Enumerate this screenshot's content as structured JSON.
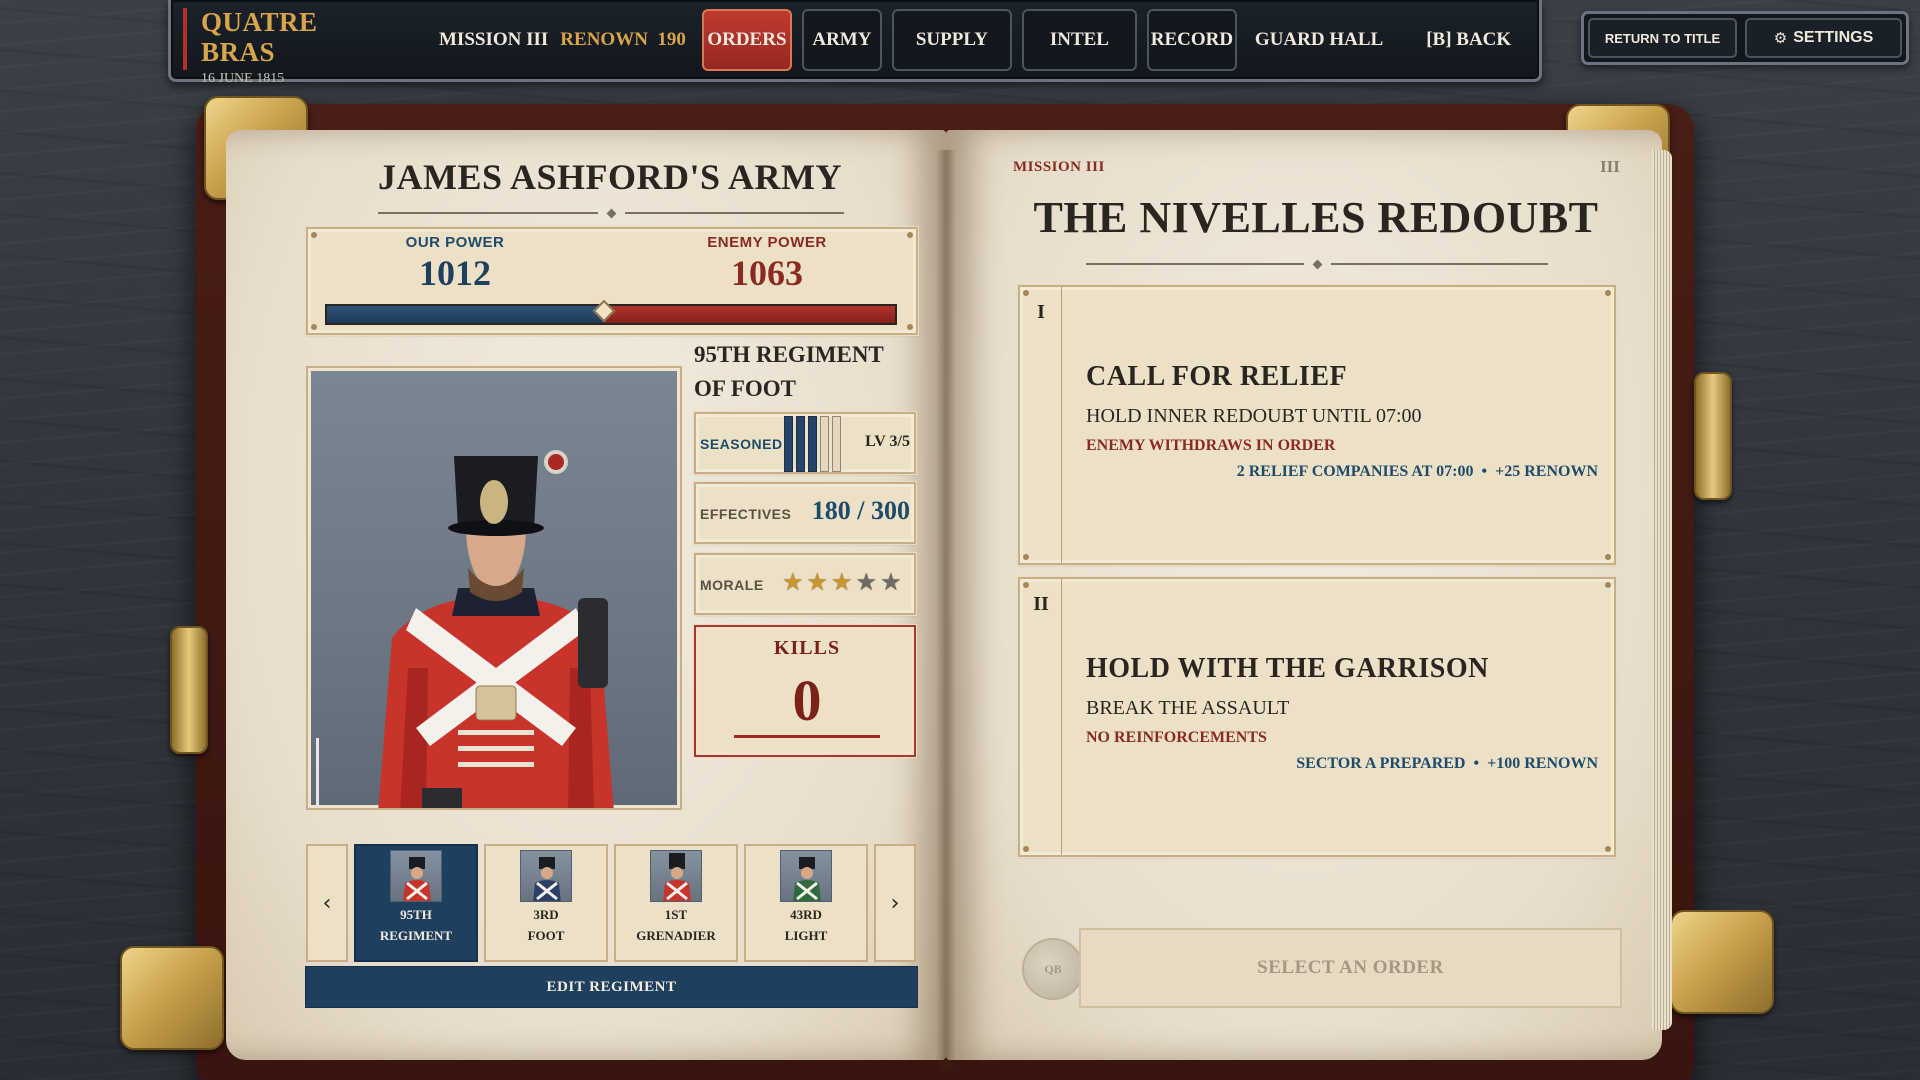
{
  "topbar": {
    "title": "QUATRE BRAS",
    "date": "16 JUNE 1815",
    "mission": "MISSION III",
    "renown_label": "RENOWN",
    "renown_value": "190",
    "nav": [
      "ORDERS",
      "ARMY",
      "SUPPLY",
      "INTEL",
      "RECORD"
    ],
    "active_nav": "ORDERS",
    "guard_hall": "GUARD HALL",
    "back": "[B]  BACK",
    "return_to_title": "RETURN TO TITLE",
    "settings": "SETTINGS",
    "settings_icon": "gear-icon"
  },
  "army": {
    "title": "JAMES ASHFORD'S ARMY",
    "our_power_label": "OUR POWER",
    "our_power": "1012",
    "enemy_power_label": "ENEMY POWER",
    "enemy_power": "1063",
    "balance_fraction": 0.488,
    "regiment_name": "95TH REGIMENT OF FOOT",
    "seasoned_label": "SEASONED",
    "experience_bars_filled": 3,
    "experience_bars_total": 5,
    "level": "LV 3/5",
    "effectives_label": "EFFECTIVES",
    "effectives": "180 / 300",
    "morale_label": "MORALE",
    "morale_stars": 3,
    "morale_max": 5,
    "kills_label": "KILLS",
    "kills": "0",
    "units": [
      {
        "line1": "95TH",
        "line2": "REGIMENT",
        "active": true
      },
      {
        "line1": "3RD",
        "line2": "FOOT",
        "active": false
      },
      {
        "line1": "1ST",
        "line2": "GRENADIER",
        "active": false
      },
      {
        "line1": "43RD",
        "line2": "LIGHT",
        "active": false
      }
    ],
    "edit_regiment": "EDIT REGIMENT",
    "prev_icon": "chevron-left-icon",
    "next_icon": "chevron-right-icon"
  },
  "mission": {
    "label": "MISSION III",
    "page_number": "III",
    "title": "THE NIVELLES REDOUBT",
    "orders": [
      {
        "num": "I",
        "title": "CALL FOR RELIEF",
        "objective": "HOLD INNER REDOUBT UNTIL 07:00",
        "condition": "ENEMY WITHDRAWS IN ORDER",
        "reward_a": "2 RELIEF COMPANIES AT 07:00",
        "reward_b": "+25 RENOWN"
      },
      {
        "num": "II",
        "title": "HOLD WITH THE GARRISON",
        "objective": "BREAK THE ASSAULT",
        "condition": "NO REINFORCEMENTS",
        "reward_a": "SECTOR A PREPARED",
        "reward_b": "+100 RENOWN"
      }
    ],
    "seal_text": "QB",
    "select_order": "SELECT AN ORDER"
  },
  "colors": {
    "accent_gold": "#d9a54a",
    "accent_red": "#b03128",
    "friendly_blue": "#1f3f5e",
    "enemy_red": "#9e2a21",
    "parchment": "#ece1c7"
  }
}
